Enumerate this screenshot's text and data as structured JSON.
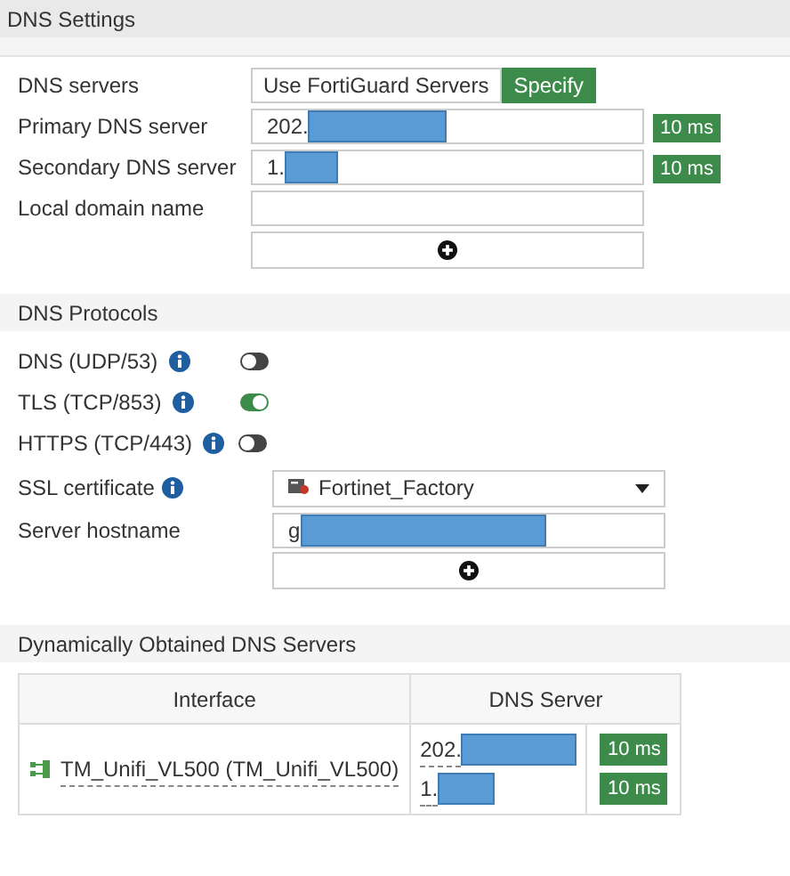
{
  "dns_settings": {
    "title": "DNS Settings",
    "dns_servers": {
      "label": "DNS servers",
      "options": [
        {
          "label": "Use FortiGuard Servers",
          "selected": false
        },
        {
          "label": "Specify",
          "selected": true
        }
      ]
    },
    "fields": [
      {
        "kind": "input",
        "label": "Primary DNS server",
        "value": "202.",
        "badge": "10 ms",
        "redacted": true
      },
      {
        "kind": "input",
        "label": "Secondary DNS server",
        "value": "1.",
        "badge": "10 ms",
        "redacted": true
      },
      {
        "kind": "input",
        "label": "Local domain name"
      },
      {
        "kind": "add"
      }
    ]
  },
  "dns_protocols": {
    "title": "DNS Protocols",
    "protocols": [
      {
        "label": "DNS (UDP/53)",
        "on": false
      },
      {
        "label": "TLS (TCP/853)",
        "on": true
      },
      {
        "label": "HTTPS (TCP/443)",
        "on": false
      }
    ],
    "ssl_certificate": {
      "label": "SSL certificate",
      "value": "Fortinet_Factory"
    },
    "server_hostname": {
      "label": "Server hostname",
      "value": "g",
      "redacted": true
    }
  },
  "dynamic_dns": {
    "title": "Dynamically Obtained DNS Servers",
    "table": {
      "columns": [
        "Interface",
        "DNS Server"
      ],
      "rows": [
        {
          "interface": "TM_Unifi_VL500 (TM_Unifi_VL500)",
          "servers": [
            {
              "value": "202.",
              "badge": "10 ms"
            },
            {
              "value": "1.",
              "badge": "10 ms"
            }
          ]
        }
      ]
    }
  }
}
